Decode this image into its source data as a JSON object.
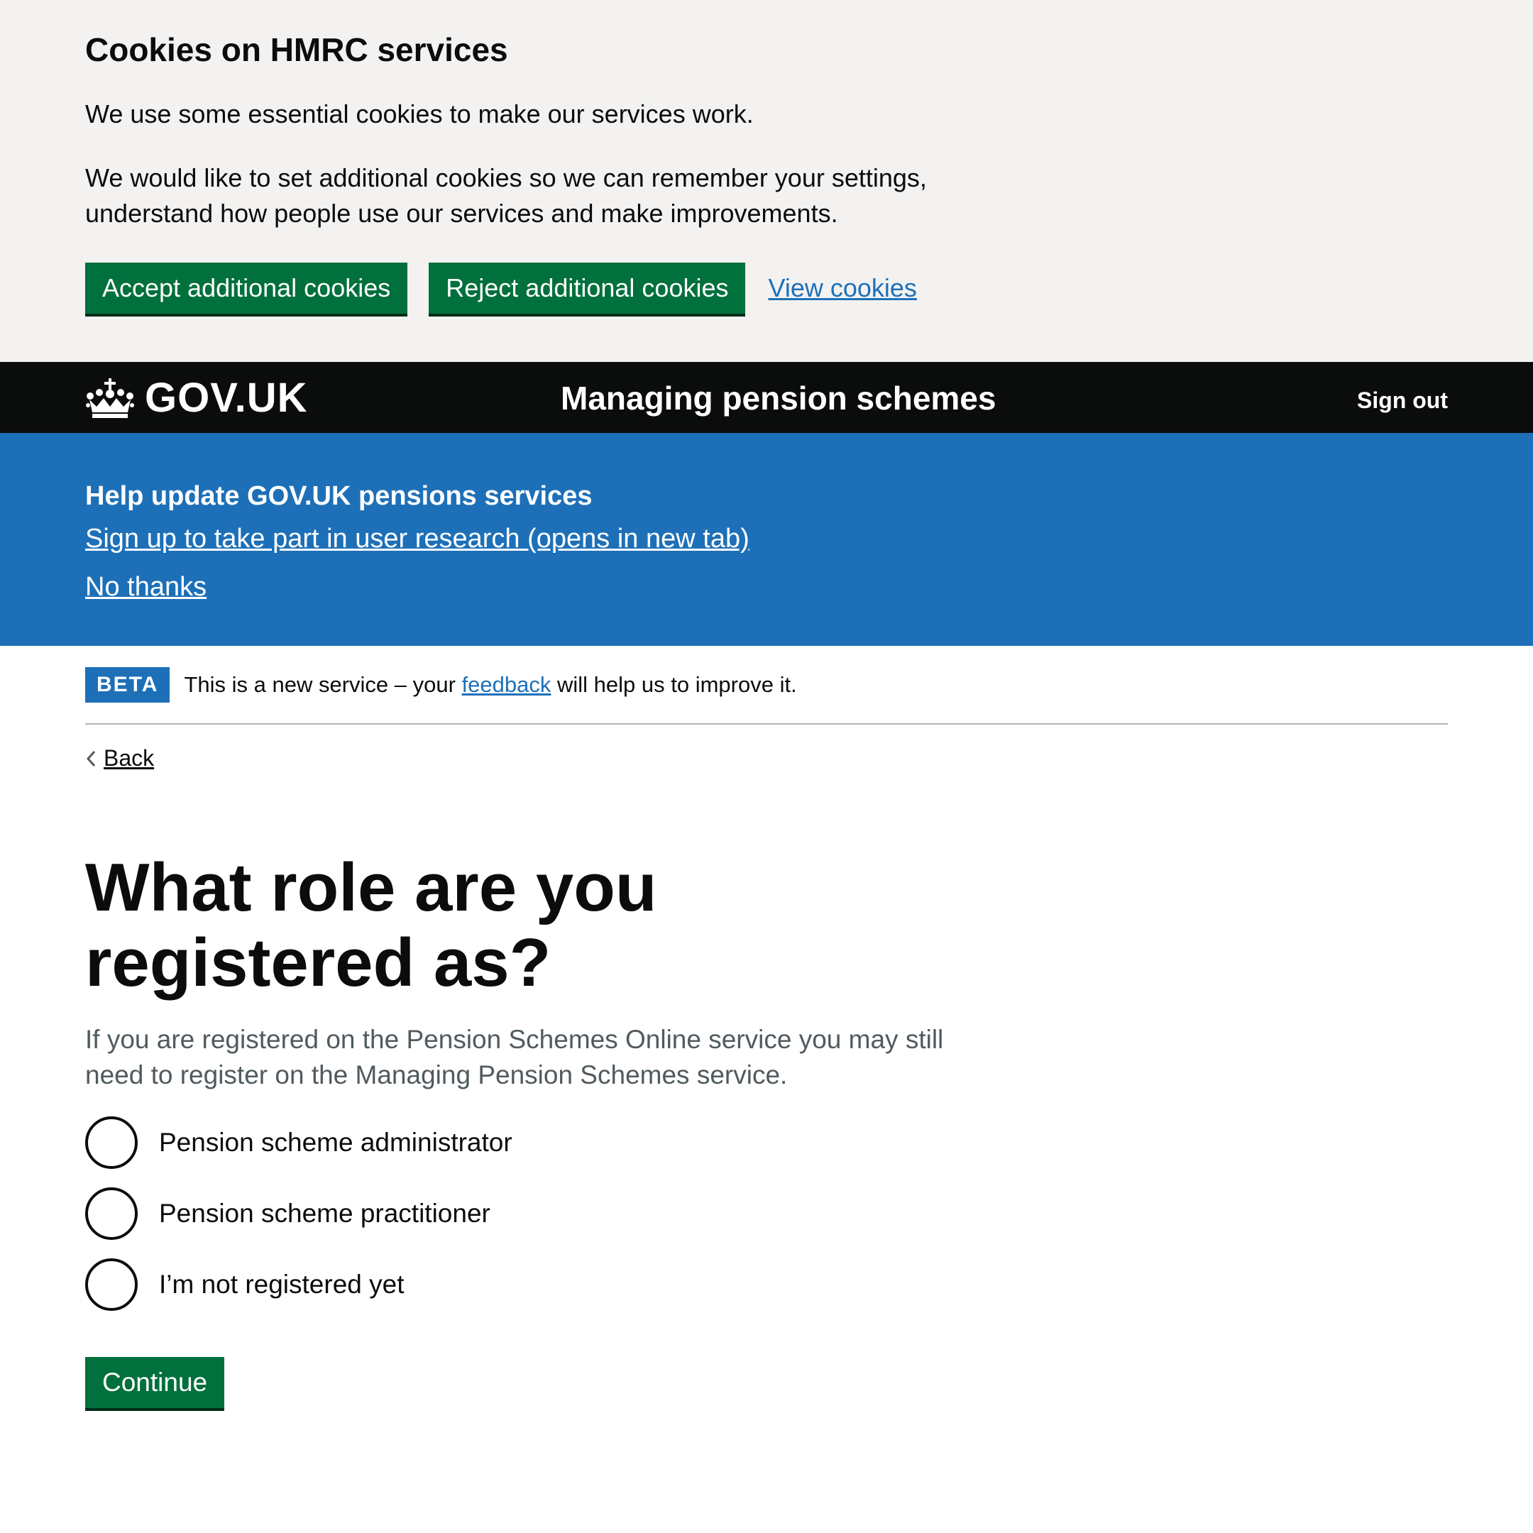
{
  "cookie_banner": {
    "title": "Cookies on HMRC services",
    "paragraph1": "We use some essential cookies to make our services work.",
    "paragraph2": "We would like to set additional cookies so we can remember your settings, understand how people use our services and make improvements.",
    "accept_label": "Accept additional cookies",
    "reject_label": "Reject additional cookies",
    "view_label": "View cookies"
  },
  "header": {
    "logo_text": "GOV.UK",
    "service_name": "Managing pension schemes",
    "sign_out_label": "Sign out"
  },
  "research_banner": {
    "title": "Help update GOV.UK pensions services",
    "signup_link": "Sign up to take part in user research (opens in new tab)",
    "dismiss_link": "No thanks"
  },
  "phase_banner": {
    "tag": "BETA",
    "text_before": "This is a new service – your",
    "link": "feedback",
    "text_after": "will help us to improve it."
  },
  "back_link": "Back",
  "question": {
    "heading": "What role are you registered as?",
    "hint": "If you are registered on the Pension Schemes Online service you may still need to register on the Managing Pension Schemes service.",
    "options": [
      "Pension scheme administrator",
      "Pension scheme practitioner",
      "I’m not registered yet"
    ]
  },
  "continue_label": "Continue",
  "colors": {
    "button_green": "#00703c",
    "link_blue": "#1d70b8",
    "header_black": "#0b0c0c",
    "banner_grey": "#f3f2f1"
  },
  "icons": {
    "logo": "crown-icon",
    "back": "chevron-left-icon"
  }
}
